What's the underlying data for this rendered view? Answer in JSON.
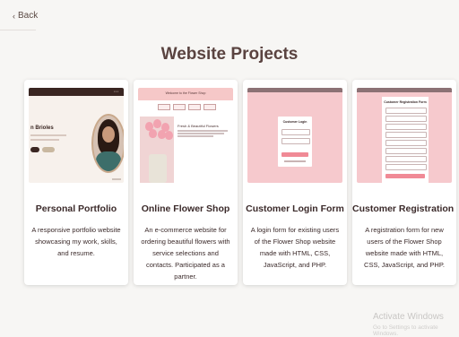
{
  "back": {
    "label": "Back"
  },
  "page": {
    "title": "Website Projects"
  },
  "projects": [
    {
      "title": "Personal Portfolio",
      "description": "A responsive portfolio website showcasing my work, skills, and resume.",
      "thumb": {
        "name_text": "n Brioles"
      }
    },
    {
      "title": "Online Flower Shop",
      "description": "An e-commerce website for ordering beautiful flowers with service selections and contacts. Participated as a partner.",
      "thumb": {
        "header_text": "Welcome to the Flower Shop",
        "product_text": "Fresh & Beautiful Flowers"
      }
    },
    {
      "title": "Customer Login Form",
      "description": "A login form for existing users of the Flower Shop website made with HTML, CSS, JavaScript, and PHP.",
      "thumb": {
        "form_title": "Customer Login"
      }
    },
    {
      "title": "Customer Registration Form",
      "description": "A registration form for new users of the Flower Shop website made with HTML, CSS, JavaScript, and PHP.",
      "thumb": {
        "form_title": "Customer Registration Form"
      }
    }
  ],
  "watermark": {
    "line1": "Activate Windows",
    "line2": "Go to Settings to activate Windows."
  }
}
